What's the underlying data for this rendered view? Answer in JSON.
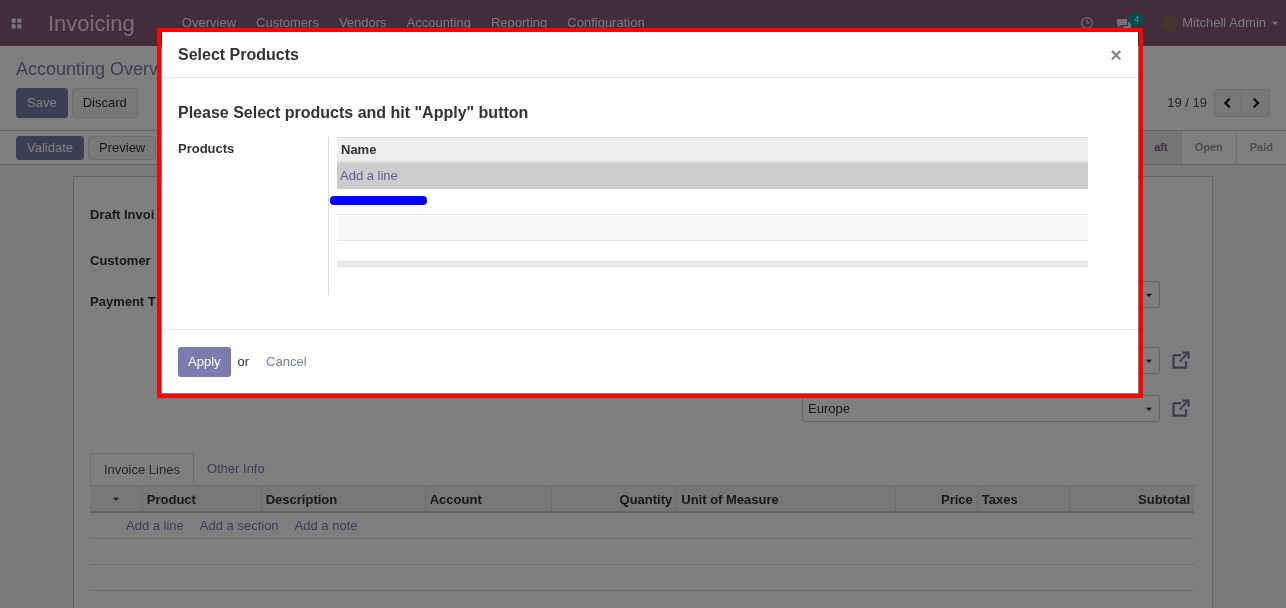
{
  "navbar": {
    "app_title": "Invoicing",
    "menu": [
      "Overview",
      "Customers",
      "Vendors",
      "Accounting",
      "Reporting",
      "Configuration"
    ],
    "notification_count": "4",
    "user": "Mitchell Admin"
  },
  "control_panel": {
    "breadcrumb": "Accounting Overv",
    "buttons": [
      {
        "label": "Save",
        "kind": "primary"
      },
      {
        "label": "Discard",
        "kind": "secondary"
      }
    ],
    "pager": "19 / 19"
  },
  "status_bar": {
    "buttons": [
      {
        "label": "Validate",
        "kind": "primary"
      },
      {
        "label": "Preview",
        "kind": "secondary"
      }
    ],
    "stages": [
      {
        "label": "aft",
        "selected": true
      },
      {
        "label": "Open",
        "selected": false
      },
      {
        "label": "Paid",
        "selected": false
      }
    ]
  },
  "form": {
    "title": "Draft Invoi",
    "fields": [
      "Customer",
      "Payment T"
    ],
    "dropdown_value": "Europe"
  },
  "notebook": {
    "tabs": [
      {
        "label": "Invoice Lines",
        "selected": true
      },
      {
        "label": "Other Info",
        "selected": false
      }
    ],
    "columns": [
      "Product",
      "Description",
      "Account",
      "Quantity",
      "Unit of Measure",
      "Price",
      "Taxes",
      "Subtotal"
    ],
    "add_links": [
      "Add a line",
      "Add a section",
      "Add a note"
    ]
  },
  "dialog": {
    "title": "Select Products",
    "close": "×",
    "heading": "Please Select products and hit \"Apply\" button",
    "field_label": "Products",
    "table": {
      "columns": [
        "Name"
      ],
      "add_link": "Add a line",
      "add_link_selected": true
    },
    "apply": "Apply",
    "separator": "or",
    "cancel": "Cancel"
  }
}
